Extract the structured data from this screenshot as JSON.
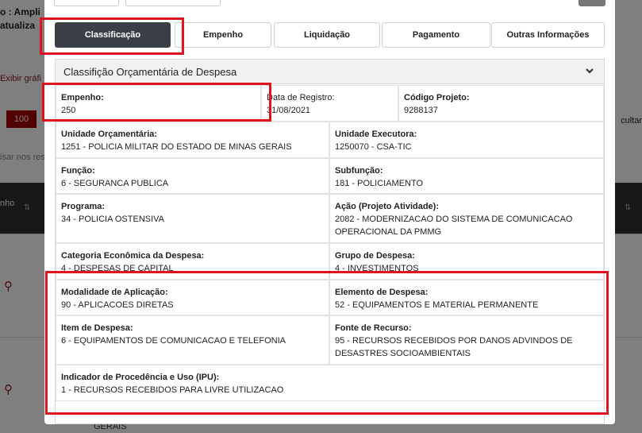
{
  "background": {
    "ampli_text": "o : Ampli",
    "atual_text": "atualiza",
    "exibir_text": "Exibir gráfi",
    "page_size": "100",
    "ocultar_text": "cultar",
    "search_placeholder": "isar nos res",
    "col_empenho": "nho",
    "sort_glyph": "⇅",
    "row_city": "GERAIS"
  },
  "tabs": [
    {
      "label": "Classificação",
      "active": true
    },
    {
      "label": "Empenho"
    },
    {
      "label": "Liquidação"
    },
    {
      "label": "Pagamento"
    },
    {
      "label": "Outras Informações"
    }
  ],
  "panel": {
    "title": "Classifição Orçamentária de Despesa",
    "fields": {
      "empenho": {
        "label": "Empenho:",
        "value": "250"
      },
      "data_registro": {
        "label": "Data de Registro:",
        "value": "31/08/2021"
      },
      "codigo_projeto": {
        "label": "Código Projeto:",
        "value": "9288137"
      },
      "unidade_orcamentaria": {
        "label": "Unidade Orçamentária:",
        "value": "1251 - POLICIA MILITAR DO ESTADO DE MINAS GERAIS"
      },
      "unidade_executora": {
        "label": "Unidade Executora:",
        "value": "1250070 - CSA-TIC"
      },
      "funcao": {
        "label": "Função:",
        "value": "6 - SEGURANCA PUBLICA"
      },
      "subfuncao": {
        "label": "Subfunção:",
        "value": "181 - POLICIAMENTO"
      },
      "programa": {
        "label": "Programa:",
        "value": "34 - POLICIA OSTENSIVA"
      },
      "acao": {
        "label": "Ação (Projeto Atividade):",
        "value": "2082 - MODERNIZACAO DO SISTEMA DE COMUNICACAO OPERACIONAL DA PMMG"
      },
      "categoria": {
        "label": "Categoria Econômica da Despesa:",
        "value": "4 - DESPESAS DE CAPITAL"
      },
      "grupo": {
        "label": "Grupo de Despesa:",
        "value": "4 - INVESTIMENTOS"
      },
      "modalidade": {
        "label": "Modalidade de Aplicação:",
        "value": "90 - APLICACOES DIRETAS"
      },
      "elemento": {
        "label": "Elemento de Despesa:",
        "value": "52 - EQUIPAMENTOS E MATERIAL PERMANENTE"
      },
      "item": {
        "label": "Item de Despesa:",
        "value": "6 - EQUIPAMENTOS DE COMUNICACAO E TELEFONIA"
      },
      "fonte": {
        "label": "Fonte de Recurso:",
        "value": "95 - RECURSOS RECEBIDOS POR DANOS ADVINDOS DE DESASTRES SOCIOAMBIENTAIS"
      },
      "ipu": {
        "label": "Indicador de Procedência e Uso (IPU):",
        "value": "1 - RECURSOS RECEBIDOS PARA LIVRE UTILIZACAO"
      }
    }
  },
  "colors": {
    "highlight": "#e0141e",
    "active_tab": "#3a3f47",
    "brand_red": "#a40000"
  }
}
